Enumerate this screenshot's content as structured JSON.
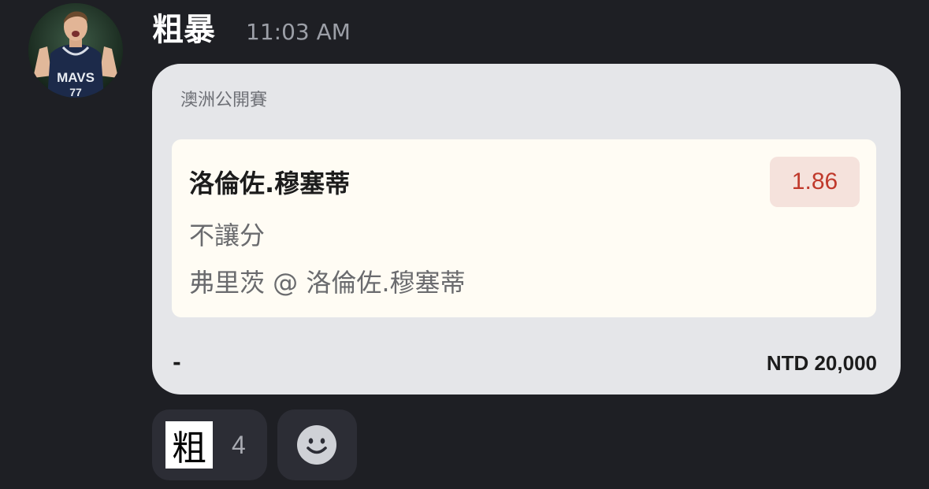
{
  "message": {
    "username": "粗暴",
    "timestamp": "11:03 AM",
    "avatar_icon": "player-avatar"
  },
  "bet_card": {
    "tournament": "澳洲公開賽",
    "selection": {
      "name": "洛倫佐.穆塞蒂",
      "odds": "1.86",
      "market": "不讓分",
      "matchup": "弗里茨 @ 洛倫佐.穆塞蒂"
    },
    "footer_left": "-",
    "stake": "NTD 20,000"
  },
  "reactions": [
    {
      "emoji": "粗",
      "count": "4"
    }
  ],
  "add_reaction_icon": "smiley-icon",
  "colors": {
    "background": "#1e1f24",
    "card": "#e5e6e9",
    "selection_box": "#fffcf4",
    "odds_text": "#c0392b",
    "odds_badge": "#f5e2dc",
    "reaction_bg": "#2c2d35"
  }
}
